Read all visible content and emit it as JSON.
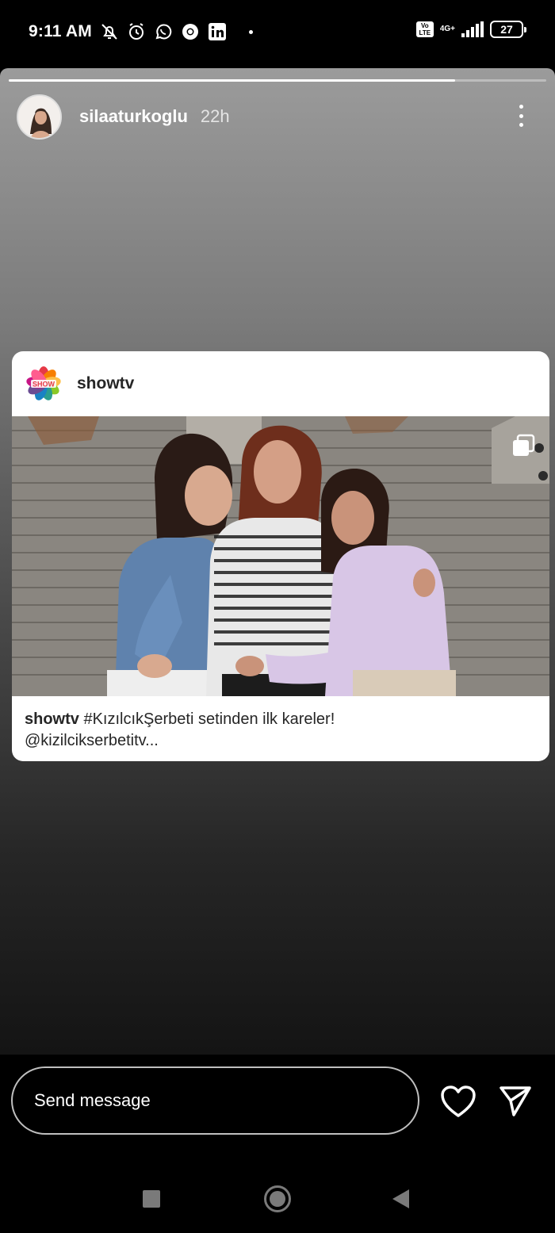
{
  "status_bar": {
    "time": "9:11 AM",
    "icons": [
      "bell-off-icon",
      "alarm-icon",
      "whatsapp-icon",
      "chrome-icon",
      "linkedin-icon"
    ],
    "volte": "Vo LTE",
    "network": "4G+",
    "battery": "27"
  },
  "story": {
    "progress": 0.83,
    "username": "silaaturkoglu",
    "time_ago": "22h"
  },
  "post": {
    "author": "showtv",
    "caption_author": "showtv",
    "caption_text": " #KızılcıkŞerbeti setinden ilk kareler!",
    "caption_more": "@kizilcikserbetitv..."
  },
  "reply": {
    "placeholder": "Send message"
  },
  "colors": {
    "story_top": "#9b9b9b",
    "story_bottom": "#141414",
    "card_bg": "#ffffff",
    "nav_icon": "#7a7a7a"
  }
}
